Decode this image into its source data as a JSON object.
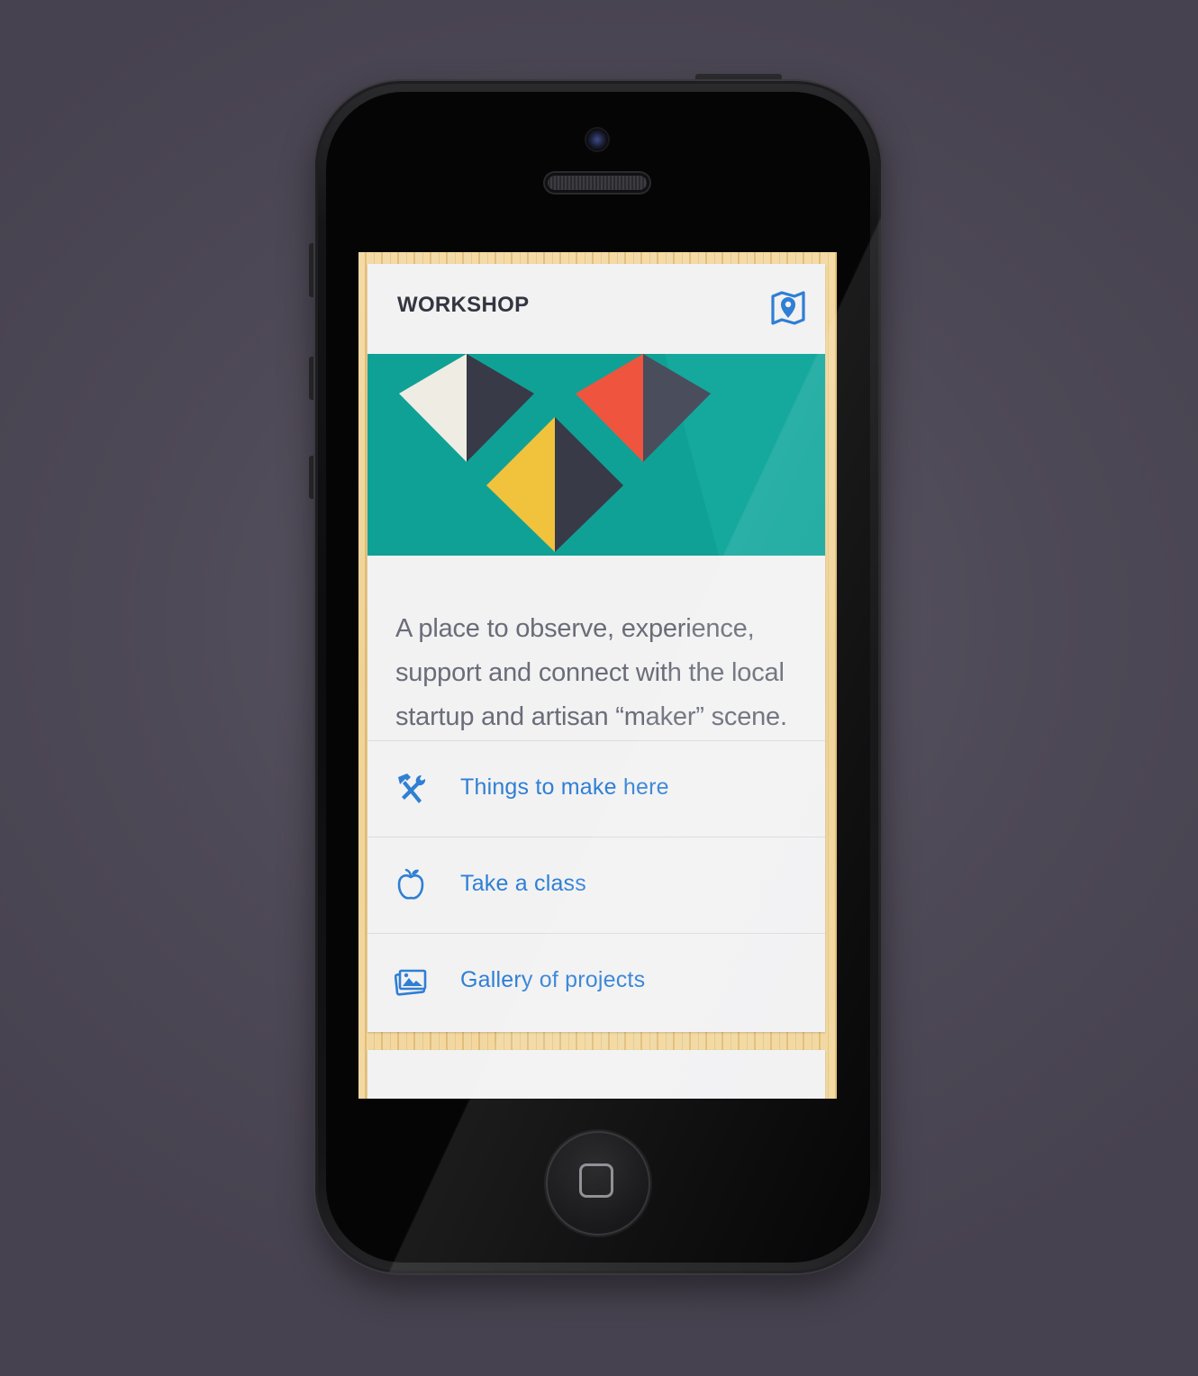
{
  "app": {
    "title": "WORKSHOP",
    "map_icon": "map-pin-icon",
    "accent_color": "#2f7fd4",
    "hero_color": "#10a196"
  },
  "card": {
    "description": "A place to observe, experience, support and connect with the local startup and artisan “maker” scene."
  },
  "menu": {
    "items": [
      {
        "label": "Things to make here",
        "icon": "tools-icon"
      },
      {
        "label": "Take a class",
        "icon": "apple-icon"
      },
      {
        "label": "Gallery of projects",
        "icon": "gallery-icon"
      }
    ]
  }
}
